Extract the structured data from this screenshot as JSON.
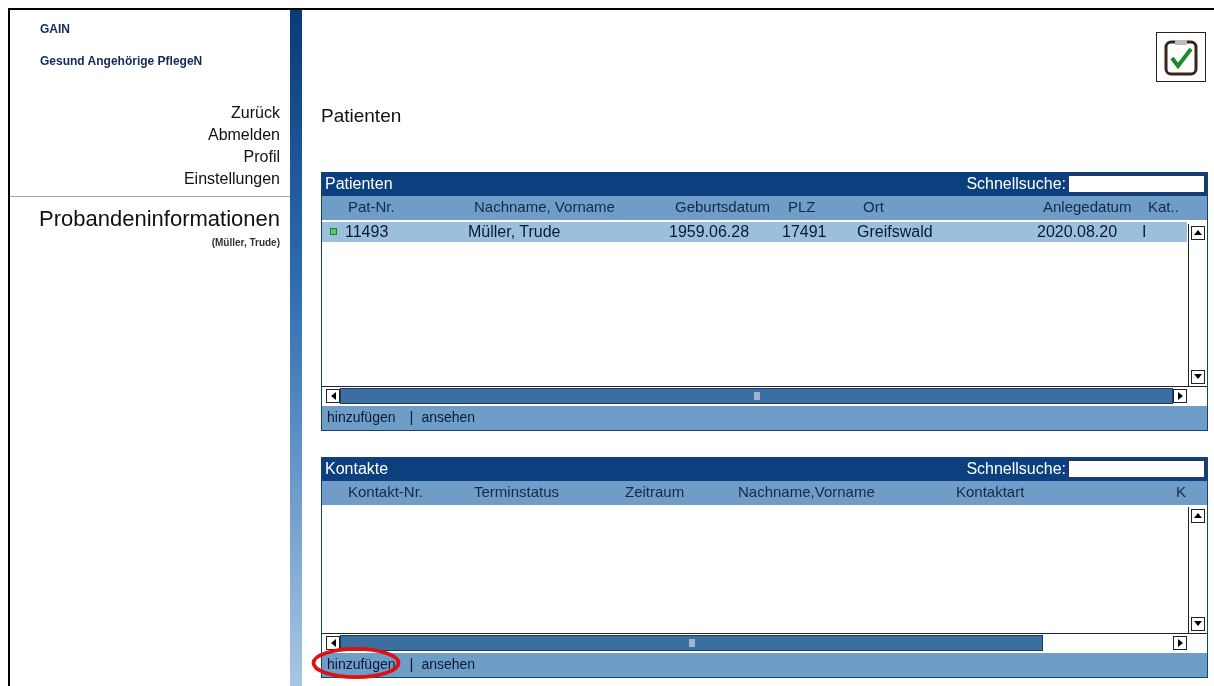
{
  "app": {
    "name": "GAIN",
    "subtitle": "Gesund Angehörige PflegeN"
  },
  "nav": [
    {
      "label": "Zurück"
    },
    {
      "label": "Abmelden"
    },
    {
      "label": "Profil"
    },
    {
      "label": "Einstellungen"
    }
  ],
  "section": {
    "title": "Probandeninformationen",
    "subject": "(Müller, Trude)"
  },
  "page_title": "Patienten",
  "panels": [
    {
      "title": "Patienten",
      "search_label": "Schnellsuche:",
      "columns": [
        "Pat-Nr.",
        "Nachname, Vorname",
        "Geburtsdatum",
        "PLZ",
        "Ort",
        "Anlegedatum",
        "Kat.."
      ],
      "rows": [
        {
          "selected": true,
          "cells": [
            "11493",
            "Müller, Trude",
            "1959.06.28",
            "17491",
            "Greifswald",
            "2020.08.20",
            "I"
          ]
        }
      ],
      "separator": "|",
      "actions": [
        {
          "label": "hinzufügen",
          "highlighted": false
        },
        {
          "label": "ansehen",
          "highlighted": false
        }
      ]
    },
    {
      "title": "Kontakte",
      "search_label": "Schnellsuche:",
      "columns": [
        "Kontakt-Nr.",
        "Terminstatus",
        "Zeitraum",
        "Nachname,Vorname",
        "Kontaktart",
        "K"
      ],
      "separator": "|",
      "actions": [
        {
          "label": "hinzufügen",
          "highlighted": true
        },
        {
          "label": "ansehen",
          "highlighted": false
        }
      ]
    }
  ]
}
